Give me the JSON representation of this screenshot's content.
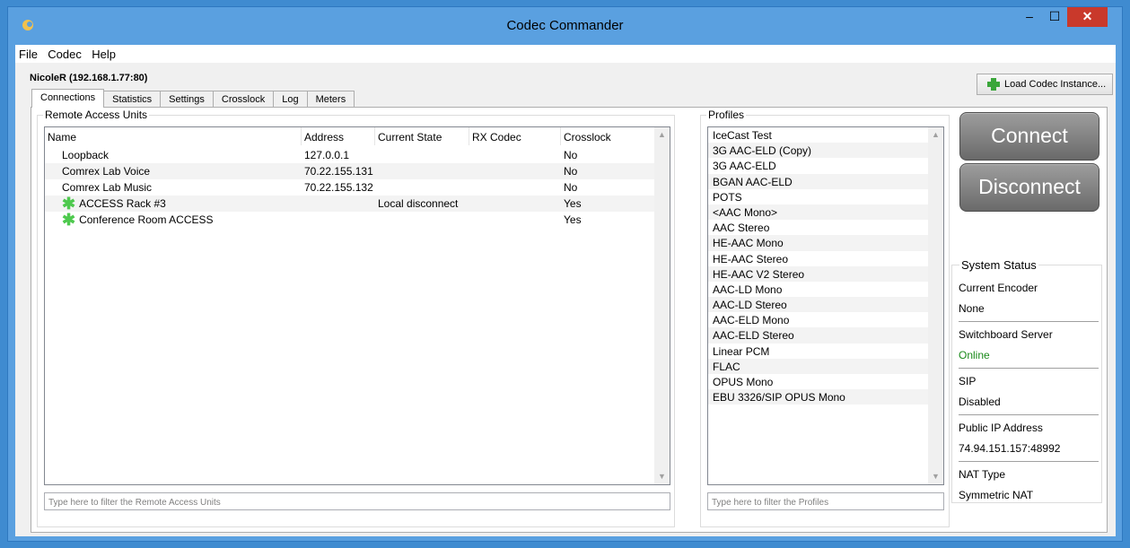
{
  "window": {
    "title": "Codec Commander",
    "minimize": "–",
    "maximize": "☐",
    "close": "✕"
  },
  "menu": [
    "File",
    "Codec",
    "Help"
  ],
  "host": "NicoleR (192.168.1.77:80)",
  "load_button": "Load Codec Instance...",
  "tabs": [
    "Connections",
    "Statistics",
    "Settings",
    "Crosslock",
    "Log",
    "Meters"
  ],
  "remote_units": {
    "label": "Remote Access Units",
    "columns": [
      "Name",
      "Address",
      "Current State",
      "RX Codec",
      "Crosslock"
    ],
    "rows": [
      {
        "name": "Loopback",
        "address": "127.0.0.1",
        "state": "",
        "rx": "",
        "crosslock": "No",
        "icon": ""
      },
      {
        "name": "Comrex Lab Voice",
        "address": "70.22.155.131",
        "state": "",
        "rx": "",
        "crosslock": "No",
        "icon": ""
      },
      {
        "name": "Comrex Lab Music",
        "address": "70.22.155.132",
        "state": "",
        "rx": "",
        "crosslock": "No",
        "icon": ""
      },
      {
        "name": "ACCESS Rack #3",
        "address": "",
        "state": "Local disconnect",
        "rx": "",
        "crosslock": "Yes",
        "icon": "green-asterisk-icon"
      },
      {
        "name": "Conference Room ACCESS",
        "address": "",
        "state": "",
        "rx": "",
        "crosslock": "Yes",
        "icon": "green-asterisk-icon"
      }
    ],
    "filter_placeholder": "Type here to filter the Remote Access Units"
  },
  "profiles": {
    "label": "Profiles",
    "items": [
      "IceCast Test",
      "3G AAC-ELD (Copy)",
      "3G AAC-ELD",
      "BGAN AAC-ELD",
      "POTS",
      "<AAC Mono>",
      "AAC Stereo",
      "HE-AAC Mono",
      "HE-AAC Stereo",
      "HE-AAC V2 Stereo",
      "AAC-LD Mono",
      "AAC-LD Stereo",
      "AAC-ELD Mono",
      "AAC-ELD Stereo",
      "Linear PCM",
      "FLAC",
      "OPUS Mono",
      "EBU 3326/SIP OPUS Mono"
    ],
    "filter_placeholder": "Type here to filter the Profiles"
  },
  "buttons": {
    "connect": "Connect",
    "disconnect": "Disconnect"
  },
  "system_status": {
    "label": "System Status",
    "current_encoder_label": "Current Encoder",
    "current_encoder": "None",
    "switchboard_label": "Switchboard Server",
    "switchboard": "Online",
    "sip_label": "SIP",
    "sip": "Disabled",
    "public_ip_label": "Public IP Address",
    "public_ip": "74.94.151.157:48992",
    "nat_label": "NAT Type",
    "nat": "Symmetric NAT"
  },
  "colors": {
    "title_bar": "#5aa0e0",
    "close_button": "#c9392b",
    "online": "#1a8a1a",
    "asterisk": "#4ec94e"
  }
}
